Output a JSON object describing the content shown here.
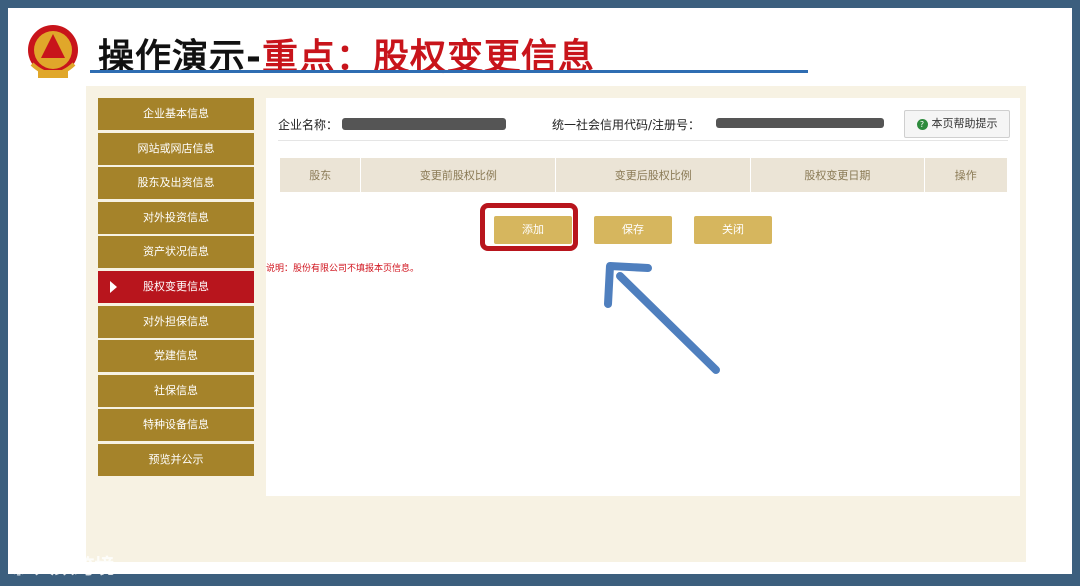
{
  "slide": {
    "title_part1": "操作演示-",
    "title_part2": "重点：股权变更信息"
  },
  "sidebar": {
    "items": [
      {
        "label": "企业基本信息"
      },
      {
        "label": "网站或网店信息"
      },
      {
        "label": "股东及出资信息"
      },
      {
        "label": "对外投资信息"
      },
      {
        "label": "资产状况信息"
      },
      {
        "label": "股权变更信息",
        "active": true
      },
      {
        "label": "对外担保信息"
      },
      {
        "label": "党建信息"
      },
      {
        "label": "社保信息"
      },
      {
        "label": "特种设备信息"
      },
      {
        "label": "预览并公示"
      }
    ]
  },
  "content": {
    "company_label": "企业名称：",
    "credit_code_label": "统一社会信用代码/注册号：",
    "help_button": "本页帮助提示",
    "table_headers": [
      "股东",
      "变更前股权比例",
      "变更后股权比例",
      "股权变更日期",
      "操作"
    ],
    "buttons": {
      "add": "添加",
      "save": "保存",
      "close": "关闭"
    },
    "note": "说明：股份有限公司不填报本页信息。"
  },
  "watermark": "大数跨境",
  "colors": {
    "sidebar_bg": "#a5832a",
    "sidebar_active": "#b8151d",
    "button_bg": "#d6b65e",
    "title_red": "#c8141b",
    "arrow_blue": "#4f7fbe"
  }
}
